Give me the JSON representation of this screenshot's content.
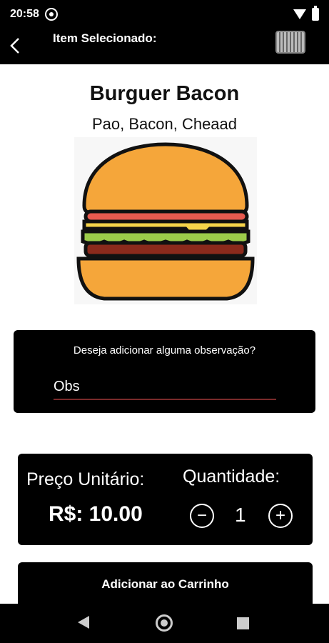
{
  "status": {
    "time": "20:58"
  },
  "appbar": {
    "title": "Item Selecionado:"
  },
  "item": {
    "name": "Burguer Bacon",
    "description": "Pao, Bacon, Cheaad"
  },
  "observation": {
    "question": "Deseja adicionar alguma observação?",
    "value": "Obs"
  },
  "pricing": {
    "unit_label": "Preço Unitário:",
    "quantity_label": "Quantidade:",
    "price": "R$: 10.00",
    "quantity": "1"
  },
  "actions": {
    "add_to_cart": "Adicionar ao Carrinho"
  },
  "icons": {
    "back": "back-arrow-icon",
    "cart": "cart-image-icon",
    "minus": "minus-circle-icon",
    "plus": "plus-circle-icon"
  }
}
